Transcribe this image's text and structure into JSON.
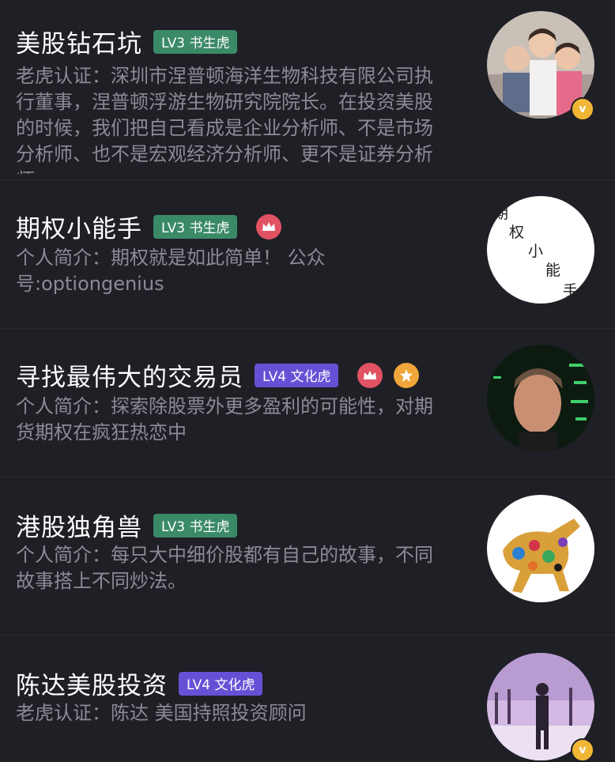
{
  "users": [
    {
      "name": "美股钻石坑",
      "level": "LV3 书生虎",
      "description": "老虎认证：深圳市涅普顿海洋生物科技有限公司执行董事，涅普顿浮游生物研究院院长。在投资美股的时候，我们把自己看成是企业分析师、不是市场分析师、也不是宏观经济分析师、更不是证券分析师。",
      "verified": true,
      "verified_glyph": "v"
    },
    {
      "name": "期权小能手",
      "level": "LV3 书生虎",
      "description": "个人简介：期权就是如此简单！ 公众号:optiongenius",
      "icons": [
        "crown-icon"
      ],
      "avatar_text": [
        "期",
        "权",
        "小",
        "能",
        "手"
      ]
    },
    {
      "name": "寻找最伟大的交易员",
      "level": "LV4 文化虎",
      "description": "个人简介：探索除股票外更多盈利的可能性，对期货期权在疯狂热恋中",
      "icons": [
        "crown-icon",
        "star-icon"
      ]
    },
    {
      "name": "港股独角兽",
      "level": "LV3 书生虎",
      "description": "个人简介：每只大中细价股都有自己的故事，不同故事搭上不同炒法。"
    },
    {
      "name": "陈达美股投资",
      "level": "LV4 文化虎",
      "description": "老虎认证：陈达 美国持照投资顾问",
      "verified": true,
      "verified_glyph": "v"
    }
  ],
  "colors": {
    "background": "#1f1f26",
    "badge_green": "#3b8a67",
    "badge_purple": "#6651d6",
    "crown": "#e15263",
    "star": "#f0a63a",
    "verified": "#f2b636",
    "desc_text": "#8b8b95"
  }
}
